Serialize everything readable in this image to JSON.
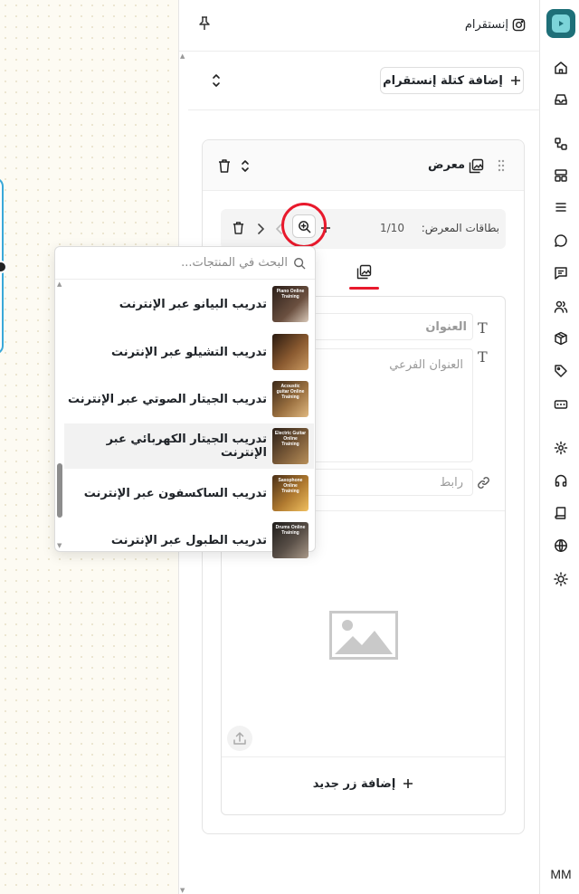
{
  "header": {
    "title": "إنستقرام",
    "pin_icon": "pin-icon",
    "instagram_icon": "instagram-icon"
  },
  "toolbar": {
    "add_block_label": "إضافة كتلة إنستقرام",
    "collapse_icon": "chevron-up-down-icon"
  },
  "gallery_block": {
    "title": "معرض",
    "cards_label": "بطاقات المعرض:",
    "cards_count": "1/10"
  },
  "editor": {
    "title_placeholder": "العنوان",
    "subtitle_placeholder": "العنوان الفرعي",
    "link_placeholder": "رابط",
    "add_button_label": "إضافة زر جديد"
  },
  "product_search": {
    "placeholder": "البحث في المنتجات...",
    "items": [
      {
        "label": "تدريب البيانو عبر الإنترنت",
        "thumb_text": "Piano Online Training",
        "color": "#3b2a22"
      },
      {
        "label": "تدريب التشيلو عبر الإنترنت",
        "thumb_text": "",
        "color": "#5a3a24"
      },
      {
        "label": "تدريب الجيتار الصوتي عبر الإنترنت",
        "thumb_text": "Acoustic guitar Online Training",
        "color": "#6b4a2a"
      },
      {
        "label": "تدريب الجيتار الكهربائي عبر الإنترنت",
        "thumb_text": "Electric Guitar Online Training",
        "color": "#4a3320"
      },
      {
        "label": "تدريب الساكسفون عبر الإنترنت",
        "thumb_text": "Saxophone Online Training",
        "color": "#7a5426"
      },
      {
        "label": "تدريب الطبول عبر الإنترنت",
        "thumb_text": "Drums Online Training",
        "color": "#3a3530"
      }
    ]
  },
  "rail": {
    "user_initials": "MM",
    "icons": [
      "home-icon",
      "inbox-icon",
      "workflow-icon",
      "layout-icon",
      "menu-icon",
      "chat-bubble-icon",
      "message-square-icon",
      "users-icon",
      "package-icon",
      "tag-icon",
      "card-icon",
      "settings-icon",
      "headphones-icon",
      "book-icon",
      "globe-icon",
      "sun-icon"
    ]
  },
  "colors": {
    "accent_red": "#e8192c",
    "logo_teal": "#1e6f78",
    "canvas_frame": "#3aa8d8"
  }
}
